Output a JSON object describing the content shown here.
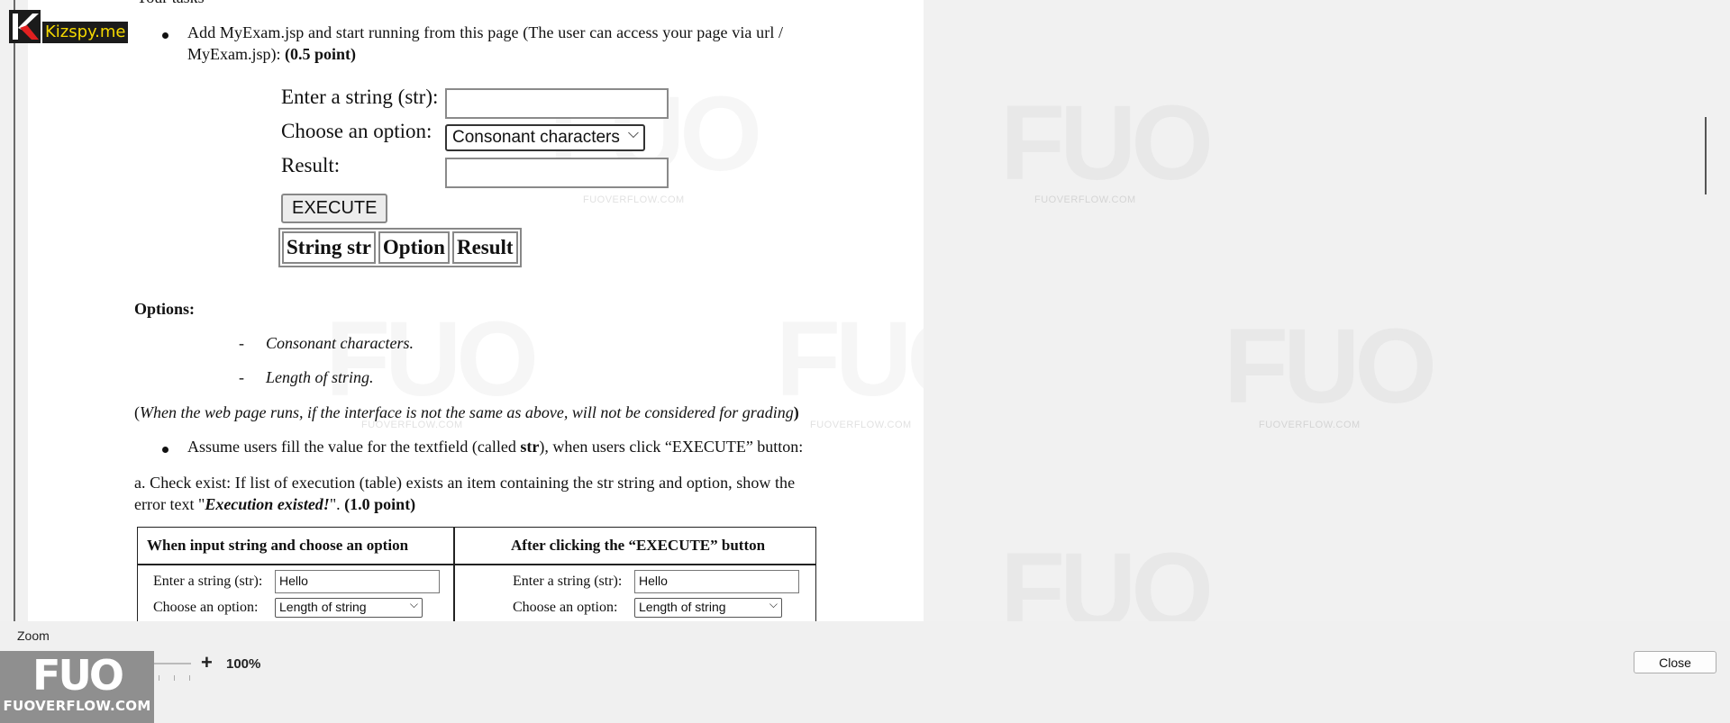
{
  "logo_top": {
    "brand": "Kizspy.me"
  },
  "logo_bottom": {
    "mark": "FUO",
    "text": "FUOVERFLOW.COM"
  },
  "watermark": {
    "mark": "FUO",
    "text": "FUOVERFLOW.COM"
  },
  "doc": {
    "heading_cut": "Your tasks",
    "bullet1_line1": "Add MyExam.jsp and start running from this page (The user can access your page via url /",
    "bullet1_line2a": "MyExam.jsp): ",
    "bullet1_line2b": "(0.5 point)",
    "demo": {
      "label_str": "Enter a string (str):",
      "label_option": "Choose an option:",
      "label_result": "Result:",
      "select_value": "Consonant characters",
      "button": "EXECUTE",
      "th": [
        "String str",
        "Option",
        "Result"
      ]
    },
    "options_heading": "Options:",
    "options": [
      "Consonant characters.",
      "Length of string."
    ],
    "note_open": "(",
    "note": "When the web page runs, if the interface is not the same as above, will not be considered for grading",
    "note_close": ")",
    "bullet2_a": "Assume users fill the value for the textfield (called ",
    "bullet2_b": "str",
    "bullet2_c": "), when users click “EXECUTE” button:",
    "para_a_line1": "a. Check exist: If list of execution (table) exists an item containing the str string and option, show the",
    "para_a_line2a": "error text \"",
    "para_a_line2b": "Execution existed!",
    "para_a_line2c": "\". ",
    "para_a_line2d": "(1.0 point)",
    "cmp": {
      "header_left": "When input string and choose an option",
      "header_right": "After clicking the “EXECUTE” button",
      "label_str": "Enter a string (str):",
      "label_option": "Choose an option:",
      "left_value": "Hello",
      "left_option": "Length of string",
      "right_value": "Hello",
      "right_option": "Length of string"
    }
  },
  "bottom": {
    "zoom_label": "Zoom",
    "minus": "-",
    "plus": "+",
    "zoom_value": "100%",
    "zoom_slider_fraction": 0.5,
    "close": "Close"
  }
}
